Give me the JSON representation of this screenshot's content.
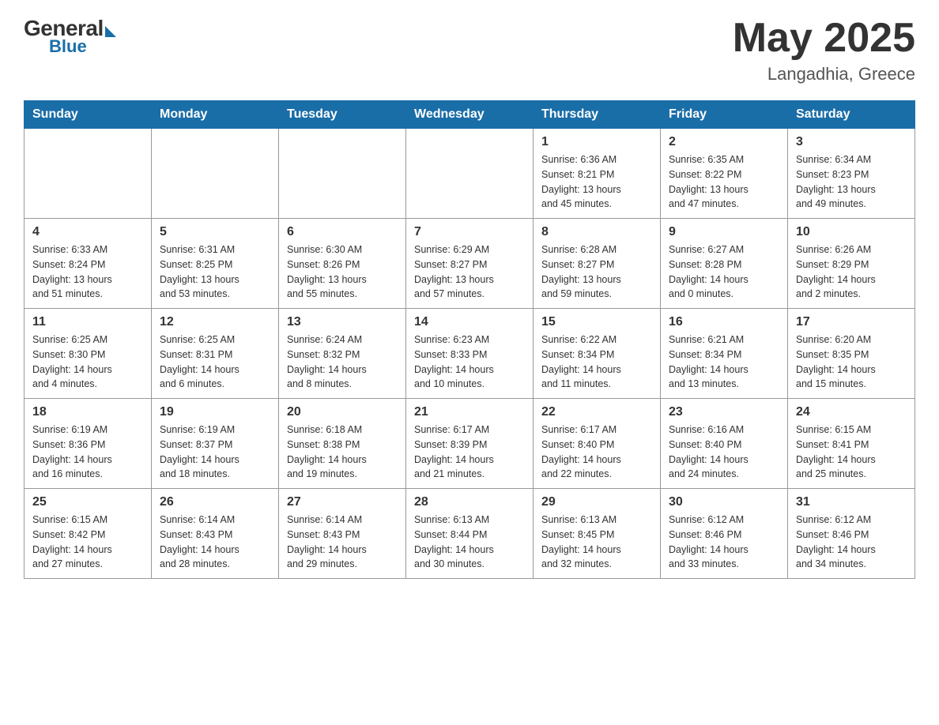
{
  "header": {
    "logo": {
      "general": "General",
      "blue": "Blue"
    },
    "title": "May 2025",
    "location": "Langadhia, Greece"
  },
  "days_of_week": [
    "Sunday",
    "Monday",
    "Tuesday",
    "Wednesday",
    "Thursday",
    "Friday",
    "Saturday"
  ],
  "weeks": [
    [
      {
        "day": "",
        "info": ""
      },
      {
        "day": "",
        "info": ""
      },
      {
        "day": "",
        "info": ""
      },
      {
        "day": "",
        "info": ""
      },
      {
        "day": "1",
        "info": "Sunrise: 6:36 AM\nSunset: 8:21 PM\nDaylight: 13 hours\nand 45 minutes."
      },
      {
        "day": "2",
        "info": "Sunrise: 6:35 AM\nSunset: 8:22 PM\nDaylight: 13 hours\nand 47 minutes."
      },
      {
        "day": "3",
        "info": "Sunrise: 6:34 AM\nSunset: 8:23 PM\nDaylight: 13 hours\nand 49 minutes."
      }
    ],
    [
      {
        "day": "4",
        "info": "Sunrise: 6:33 AM\nSunset: 8:24 PM\nDaylight: 13 hours\nand 51 minutes."
      },
      {
        "day": "5",
        "info": "Sunrise: 6:31 AM\nSunset: 8:25 PM\nDaylight: 13 hours\nand 53 minutes."
      },
      {
        "day": "6",
        "info": "Sunrise: 6:30 AM\nSunset: 8:26 PM\nDaylight: 13 hours\nand 55 minutes."
      },
      {
        "day": "7",
        "info": "Sunrise: 6:29 AM\nSunset: 8:27 PM\nDaylight: 13 hours\nand 57 minutes."
      },
      {
        "day": "8",
        "info": "Sunrise: 6:28 AM\nSunset: 8:27 PM\nDaylight: 13 hours\nand 59 minutes."
      },
      {
        "day": "9",
        "info": "Sunrise: 6:27 AM\nSunset: 8:28 PM\nDaylight: 14 hours\nand 0 minutes."
      },
      {
        "day": "10",
        "info": "Sunrise: 6:26 AM\nSunset: 8:29 PM\nDaylight: 14 hours\nand 2 minutes."
      }
    ],
    [
      {
        "day": "11",
        "info": "Sunrise: 6:25 AM\nSunset: 8:30 PM\nDaylight: 14 hours\nand 4 minutes."
      },
      {
        "day": "12",
        "info": "Sunrise: 6:25 AM\nSunset: 8:31 PM\nDaylight: 14 hours\nand 6 minutes."
      },
      {
        "day": "13",
        "info": "Sunrise: 6:24 AM\nSunset: 8:32 PM\nDaylight: 14 hours\nand 8 minutes."
      },
      {
        "day": "14",
        "info": "Sunrise: 6:23 AM\nSunset: 8:33 PM\nDaylight: 14 hours\nand 10 minutes."
      },
      {
        "day": "15",
        "info": "Sunrise: 6:22 AM\nSunset: 8:34 PM\nDaylight: 14 hours\nand 11 minutes."
      },
      {
        "day": "16",
        "info": "Sunrise: 6:21 AM\nSunset: 8:34 PM\nDaylight: 14 hours\nand 13 minutes."
      },
      {
        "day": "17",
        "info": "Sunrise: 6:20 AM\nSunset: 8:35 PM\nDaylight: 14 hours\nand 15 minutes."
      }
    ],
    [
      {
        "day": "18",
        "info": "Sunrise: 6:19 AM\nSunset: 8:36 PM\nDaylight: 14 hours\nand 16 minutes."
      },
      {
        "day": "19",
        "info": "Sunrise: 6:19 AM\nSunset: 8:37 PM\nDaylight: 14 hours\nand 18 minutes."
      },
      {
        "day": "20",
        "info": "Sunrise: 6:18 AM\nSunset: 8:38 PM\nDaylight: 14 hours\nand 19 minutes."
      },
      {
        "day": "21",
        "info": "Sunrise: 6:17 AM\nSunset: 8:39 PM\nDaylight: 14 hours\nand 21 minutes."
      },
      {
        "day": "22",
        "info": "Sunrise: 6:17 AM\nSunset: 8:40 PM\nDaylight: 14 hours\nand 22 minutes."
      },
      {
        "day": "23",
        "info": "Sunrise: 6:16 AM\nSunset: 8:40 PM\nDaylight: 14 hours\nand 24 minutes."
      },
      {
        "day": "24",
        "info": "Sunrise: 6:15 AM\nSunset: 8:41 PM\nDaylight: 14 hours\nand 25 minutes."
      }
    ],
    [
      {
        "day": "25",
        "info": "Sunrise: 6:15 AM\nSunset: 8:42 PM\nDaylight: 14 hours\nand 27 minutes."
      },
      {
        "day": "26",
        "info": "Sunrise: 6:14 AM\nSunset: 8:43 PM\nDaylight: 14 hours\nand 28 minutes."
      },
      {
        "day": "27",
        "info": "Sunrise: 6:14 AM\nSunset: 8:43 PM\nDaylight: 14 hours\nand 29 minutes."
      },
      {
        "day": "28",
        "info": "Sunrise: 6:13 AM\nSunset: 8:44 PM\nDaylight: 14 hours\nand 30 minutes."
      },
      {
        "day": "29",
        "info": "Sunrise: 6:13 AM\nSunset: 8:45 PM\nDaylight: 14 hours\nand 32 minutes."
      },
      {
        "day": "30",
        "info": "Sunrise: 6:12 AM\nSunset: 8:46 PM\nDaylight: 14 hours\nand 33 minutes."
      },
      {
        "day": "31",
        "info": "Sunrise: 6:12 AM\nSunset: 8:46 PM\nDaylight: 14 hours\nand 34 minutes."
      }
    ]
  ]
}
